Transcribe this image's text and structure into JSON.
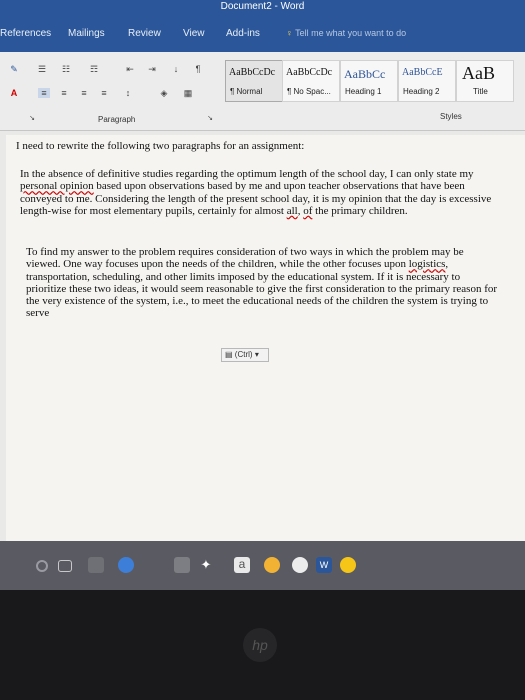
{
  "window": {
    "title": "Document2 - Word"
  },
  "tabs": [
    "References",
    "Mailings",
    "Review",
    "View",
    "Add-ins"
  ],
  "tell_me": "Tell me what you want to do",
  "ribbon": {
    "paragraph_label": "Paragraph",
    "styles_label": "Styles",
    "styles": [
      {
        "preview": "AaBbCcDc",
        "name": "¶ Normal"
      },
      {
        "preview": "AaBbCcDc",
        "name": "¶ No Spac..."
      },
      {
        "preview": "AaBbCc",
        "name": "Heading 1"
      },
      {
        "preview": "AaBbCcE",
        "name": "Heading 2"
      },
      {
        "preview": "AaB",
        "name": "Title"
      }
    ]
  },
  "document": {
    "intro": "I need to rewrite the following two paragraphs for an assignment:",
    "p1": {
      "a": "In the absence of definitive studies regarding the optimum length of the school day, I can only state my ",
      "b": "personal opinion",
      "c": " based upon observations based by me and upon teacher observations that have been conveyed to me. Considering the length of the present school day, it is my opinion that the day is excessive length-wise for most elementary pupils, certainly for almost ",
      "d": "all",
      "e": ", ",
      "f": "of",
      "g": " the primary children."
    },
    "p2": {
      "a": "To find my answer to the problem requires consideration of two ways in which the problem may be viewed. One way focuses upon the needs of the children, while the other focuses upon ",
      "b": "logistics",
      "c": ", transportation, scheduling, and other limits imposed by the educational system. If it is necessary to prioritize these two ideas, it would seem reasonable to give the first consideration to the primary reason for the very existence of the system, i.e., to meet the educational needs of the children the system is trying to serve"
    },
    "paste_options": "(Ctrl)"
  },
  "taskbar": {
    "store_letter": "a"
  },
  "colors": {
    "ribbon_blue": "#2b579a",
    "taskbar": "#5a5b62"
  }
}
